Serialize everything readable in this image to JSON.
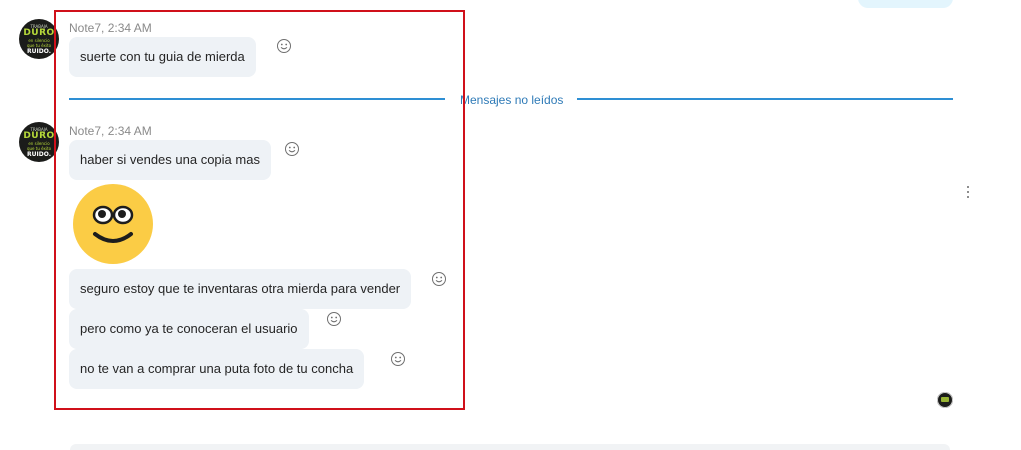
{
  "colors": {
    "accent": "#2e8fd4",
    "highlight_border": "#d0101a",
    "bubble_bg": "#eef2f6",
    "own_bubble_bg": "#e3f5fd",
    "emoji_yellow": "#fbcc45"
  },
  "icons": {
    "reaction": "smiley-outline-icon",
    "more": "vertical-ellipsis-icon",
    "sticker": "smiling-face-emoji"
  },
  "avatar": {
    "lines": [
      "TRABAJA",
      "DURO",
      "en silencio",
      "que tu éxito",
      "sea tu",
      "RUIDO."
    ]
  },
  "group1": {
    "meta": "Note7, 2:34 AM",
    "messages": [
      {
        "text": "suerte con tu guia de mierda"
      }
    ]
  },
  "divider": {
    "label": "Mensajes no leídos"
  },
  "group2": {
    "meta": "Note7, 2:34 AM",
    "messages": [
      {
        "text": "haber si vendes una copia mas"
      },
      {
        "text": "seguro estoy que te inventaras otra mierda para vender"
      },
      {
        "text": "pero como ya te conoceran el usuario"
      },
      {
        "text": "no te van a comprar una puta foto de tu concha"
      }
    ]
  }
}
